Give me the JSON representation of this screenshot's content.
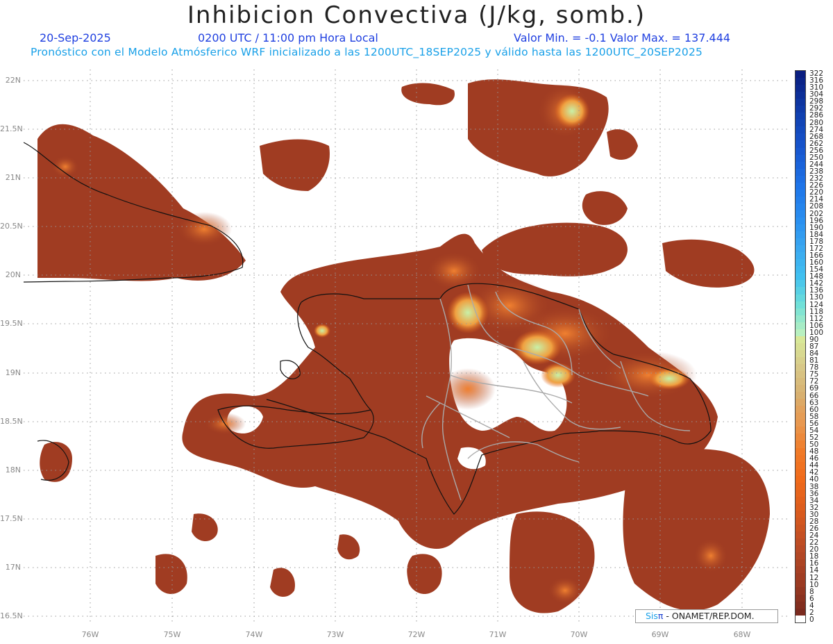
{
  "title": "Inhibicion Convectiva (J/kg, somb.)",
  "info": {
    "date": "20-Sep-2025",
    "time": "0200 UTC / 11:00 pm Hora Local",
    "min_max": "Valor Min. = -0.1  Valor Max. = 137.444"
  },
  "subtitle": "Pronóstico con el Modelo Atmósferico WRF inicializado a las 1200UTC_18SEP2025 y válido hasta las  1200UTC_20SEP2025",
  "map": {
    "lat_labels": [
      "22N",
      "21.5N",
      "21N",
      "20.5N",
      "20N",
      "19.5N",
      "19N",
      "18.5N",
      "18N",
      "17.5N",
      "17N",
      "16.5N"
    ],
    "lon_labels": [
      "76W",
      "75W",
      "74W",
      "73W",
      "72W",
      "71W",
      "70W",
      "69W",
      "68W"
    ],
    "fill_color": "#a03c22",
    "accent_color": "#e8641a",
    "highlight_color": "#c8e890",
    "peak_color": "#7ee0b8"
  },
  "colorbar": {
    "labels": [
      "322",
      "316",
      "310",
      "304",
      "298",
      "292",
      "286",
      "280",
      "274",
      "268",
      "262",
      "256",
      "250",
      "244",
      "238",
      "232",
      "226",
      "220",
      "214",
      "208",
      "202",
      "196",
      "190",
      "184",
      "178",
      "172",
      "166",
      "160",
      "154",
      "148",
      "142",
      "136",
      "130",
      "124",
      "118",
      "112",
      "106",
      "100",
      "90",
      "87",
      "84",
      "81",
      "78",
      "75",
      "72",
      "69",
      "66",
      "63",
      "60",
      "58",
      "56",
      "54",
      "52",
      "50",
      "48",
      "46",
      "44",
      "42",
      "40",
      "38",
      "36",
      "34",
      "32",
      "30",
      "28",
      "26",
      "24",
      "22",
      "20",
      "18",
      "16",
      "14",
      "12",
      "10",
      "8",
      "6",
      "4",
      "2",
      "0"
    ]
  },
  "credit": {
    "sis": "Sis",
    "pi": "π",
    "org": " - ONAMET/REP.DOM."
  }
}
